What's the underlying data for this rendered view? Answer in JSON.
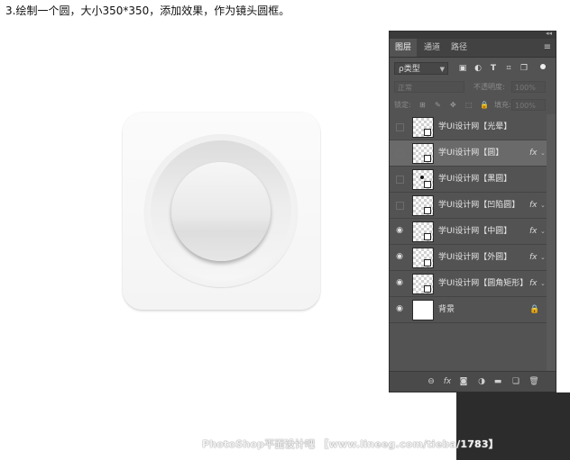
{
  "instruction": "3.绘制一个圆，大小350*350，添加效果，作为镜头圆框。",
  "panel": {
    "tabs": [
      "图层",
      "通道",
      "路径"
    ],
    "filter_label": "ρ类型",
    "filter_icons": [
      "image-icon",
      "adjust-icon",
      "text-icon",
      "shape-icon",
      "smart-object-icon"
    ],
    "blend_mode": "正常",
    "opacity_label": "不透明度:",
    "opacity_value": "100%",
    "lock_label": "锁定:",
    "fill_label": "填充:",
    "fill_value": "100%",
    "layers": [
      {
        "name": "学UI设计网【光晕】",
        "visible": false,
        "fx": false
      },
      {
        "name": "学UI设计网【圆】",
        "visible": false,
        "fx": true,
        "selected": true
      },
      {
        "name": "学UI设计网【黑圆】",
        "visible": false,
        "fx": false
      },
      {
        "name": "学UI设计网【凹陷圆】",
        "visible": false,
        "fx": true
      },
      {
        "name": "学UI设计网【中圆】",
        "visible": true,
        "fx": true
      },
      {
        "name": "学UI设计网【外圆】",
        "visible": true,
        "fx": true
      },
      {
        "name": "学UI设计网【圆角矩形】",
        "visible": true,
        "fx": true
      },
      {
        "name": "背景",
        "visible": true,
        "fx": false,
        "locked": true
      }
    ],
    "fx_label": "fx",
    "bottom_icons": [
      "link-icon",
      "fx-icon",
      "mask-icon",
      "adjustment-icon",
      "folder-icon",
      "new-layer-icon",
      "trash-icon"
    ]
  },
  "watermark": "PhotoShop平面设计吧 【www.lineeg.com/tieba/1783】",
  "colors": {
    "panel_bg": "#535353",
    "selected_row": "#6a6a6a",
    "canvas_bg": "#ffffff"
  }
}
